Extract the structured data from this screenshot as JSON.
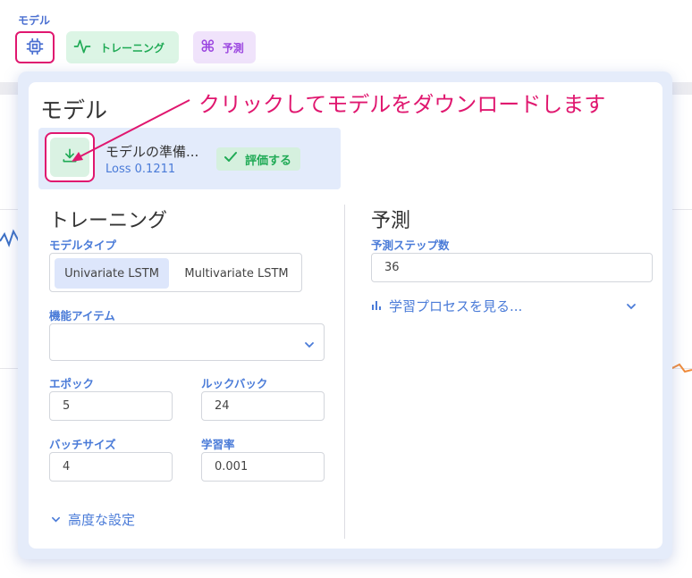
{
  "header": {
    "label": "モデル",
    "tabs": {
      "model": {
        "icon": "cpu-chip-icon"
      },
      "training": {
        "label": "トレーニング",
        "icon": "activity-pulse-icon"
      },
      "prediction": {
        "label": "予測",
        "icon": "command-icon"
      }
    }
  },
  "popup": {
    "title": "モデル",
    "annotation": "クリックしてモデルをダウンロードします",
    "model": {
      "status": "モデルの準備...",
      "loss": "Loss 0.1211",
      "download_icon": "download-icon",
      "evaluate_label": "評価する",
      "evaluate_icon": "check-icon"
    },
    "training": {
      "title": "トレーニング",
      "model_type_label": "モデルタイプ",
      "model_types": [
        "Univariate LSTM",
        "Multivariate LSTM"
      ],
      "model_type_selected": "Univariate LSTM",
      "features_label": "機能アイテム",
      "epochs_label": "エポック",
      "epochs_value": "5",
      "lookback_label": "ルックバック",
      "lookback_value": "24",
      "batch_label": "バッチサイズ",
      "batch_value": "4",
      "lr_label": "学習率",
      "lr_value": "0.001",
      "advanced_label": "高度な設定"
    },
    "prediction": {
      "title": "予測",
      "steps_label": "予測ステップ数",
      "steps_value": "36",
      "process_link": "学習プロセスを見る..."
    }
  },
  "colors": {
    "accent_blue": "#4a7bd8",
    "highlight_pink": "#e0176f",
    "green": "#1faa55",
    "purple": "#9b46e0"
  }
}
